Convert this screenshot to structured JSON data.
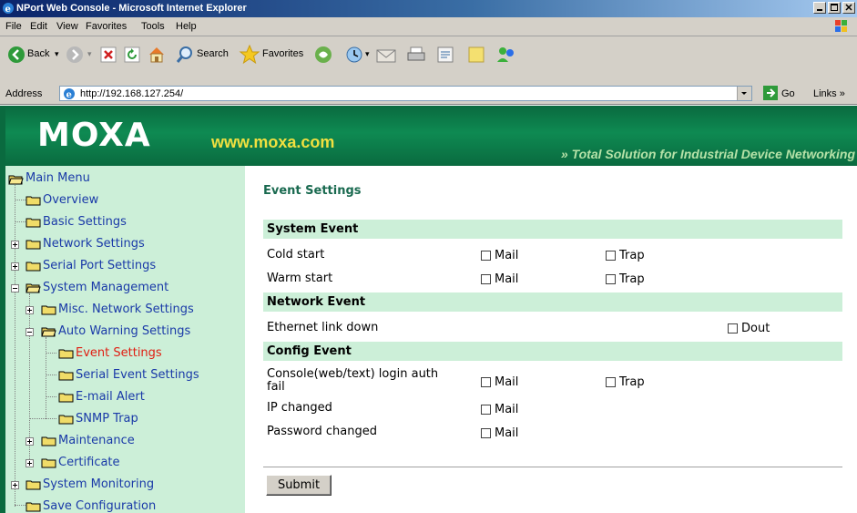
{
  "window": {
    "title": "NPort Web Console - Microsoft Internet Explorer"
  },
  "menu": [
    "File",
    "Edit",
    "View",
    "Favorites",
    "Tools",
    "Help"
  ],
  "toolbar": {
    "back": "Back",
    "search": "Search",
    "favorites": "Favorites"
  },
  "address": {
    "label": "Address",
    "url": "http://192.168.127.254/",
    "go": "Go",
    "links": "Links"
  },
  "banner": {
    "logo": "MOXA",
    "site": "www.moxa.com",
    "tagline": "Total Solution for Industrial Device Networking"
  },
  "sidebar": {
    "root": "Main Menu",
    "items": [
      {
        "label": "Overview"
      },
      {
        "label": "Basic Settings"
      },
      {
        "label": "Network Settings"
      },
      {
        "label": "Serial Port Settings"
      },
      {
        "label": "System Management"
      },
      {
        "label": "Misc. Network Settings"
      },
      {
        "label": "Auto Warning Settings"
      },
      {
        "label": "Event Settings"
      },
      {
        "label": "Serial Event Settings"
      },
      {
        "label": "E-mail Alert"
      },
      {
        "label": "SNMP Trap"
      },
      {
        "label": "Maintenance"
      },
      {
        "label": "Certificate"
      },
      {
        "label": "System Monitoring"
      },
      {
        "label": "Save Configuration"
      }
    ]
  },
  "main": {
    "heading": "Event Settings",
    "sections": {
      "system": "System Event",
      "network": "Network Event",
      "config": "Config Event"
    },
    "rows": {
      "cold_start": "Cold start",
      "warm_start": "Warm start",
      "ethernet_down": "Ethernet link down",
      "console_login_1": "Console(web/text) login auth",
      "console_login_2": "fail",
      "ip_changed": "IP changed",
      "password_changed": "Password changed"
    },
    "options": {
      "mail": "Mail",
      "trap": "Trap",
      "dout": "Dout"
    },
    "submit": "Submit"
  }
}
